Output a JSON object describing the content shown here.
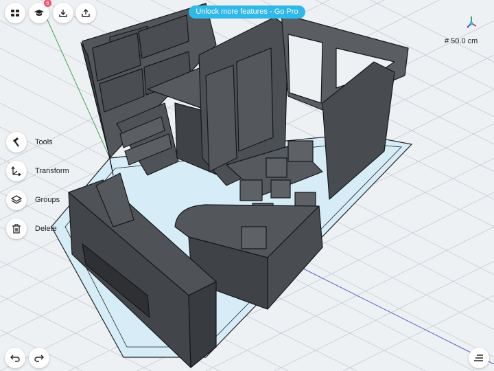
{
  "toolbar": {
    "grid_icon": "grid-icon",
    "learn_icon": "graduation-cap-icon",
    "learn_badge": "6",
    "import_icon": "download-icon",
    "export_icon": "share-icon"
  },
  "promo": {
    "label": "Unlock more features - Go Pro",
    "color": "#2fb8e8"
  },
  "grid": {
    "size_label": "# 50.0 cm"
  },
  "tools": [
    {
      "label": "Tools",
      "icon": "hammer-icon"
    },
    {
      "label": "Transform",
      "icon": "transform-icon"
    },
    {
      "label": "Groups",
      "icon": "layers-icon"
    },
    {
      "label": "Delete",
      "icon": "trash-icon"
    }
  ],
  "bottom": {
    "undo_icon": "undo-icon",
    "redo_icon": "redo-icon",
    "menu_icon": "menu-icon"
  },
  "colors": {
    "model": "#474b50",
    "floor": "#d6ecf6",
    "accent": "#2fb8e8",
    "background": "#eef1f4"
  }
}
